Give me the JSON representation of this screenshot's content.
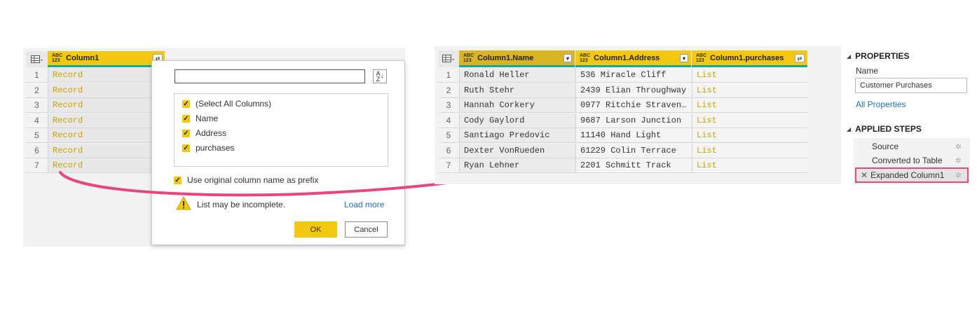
{
  "left_table": {
    "column_header": "Column1",
    "type_icon": "ABC 123",
    "rows": [
      {
        "num": "1",
        "value": "Record"
      },
      {
        "num": "2",
        "value": "Record"
      },
      {
        "num": "3",
        "value": "Record"
      },
      {
        "num": "4",
        "value": "Record"
      },
      {
        "num": "5",
        "value": "Record"
      },
      {
        "num": "6",
        "value": "Record"
      },
      {
        "num": "7",
        "value": "Record"
      }
    ]
  },
  "expand_popup": {
    "search_value": "",
    "sort_icon": "sort-az-icon",
    "options": [
      {
        "label": "(Select All Columns)",
        "checked": true
      },
      {
        "label": "Name",
        "checked": true
      },
      {
        "label": "Address",
        "checked": true
      },
      {
        "label": "purchases",
        "checked": true
      }
    ],
    "prefix_option": "Use original column name as prefix",
    "warning_text": "List may be incomplete.",
    "load_more": "Load more",
    "ok_label": "OK",
    "cancel_label": "Cancel"
  },
  "right_table": {
    "headers": [
      "Column1.Name",
      "Column1.Address",
      "Column1.purchases"
    ],
    "rows": [
      {
        "num": "1",
        "name": "Ronald Heller",
        "address": "536 Miracle Cliff",
        "purchases": "List"
      },
      {
        "num": "2",
        "name": "Ruth Stehr",
        "address": "2439 Elian Throughway",
        "purchases": "List"
      },
      {
        "num": "3",
        "name": "Hannah Corkery",
        "address": "0977 Ritchie Straven…",
        "purchases": "List"
      },
      {
        "num": "4",
        "name": "Cody Gaylord",
        "address": "9687 Larson Junction",
        "purchases": "List"
      },
      {
        "num": "5",
        "name": "Santiago Predovic",
        "address": "11140 Hand Light",
        "purchases": "List"
      },
      {
        "num": "6",
        "name": "Dexter VonRueden",
        "address": "61229 Colin Terrace",
        "purchases": "List"
      },
      {
        "num": "7",
        "name": "Ryan Lehner",
        "address": "2201 Schmitt Track",
        "purchases": "List"
      }
    ]
  },
  "properties": {
    "title": "PROPERTIES",
    "name_label": "Name",
    "name_value": "Customer Purchases",
    "all_properties": "All Properties"
  },
  "applied_steps": {
    "title": "APPLIED STEPS",
    "steps": [
      "Source",
      "Converted to Table",
      "Expanded Column1"
    ]
  },
  "colors": {
    "header_yellow": "#f2c811",
    "teal_underline": "#14a89c",
    "arrow_pink": "#e8467c",
    "link_blue": "#1f6fbf"
  }
}
